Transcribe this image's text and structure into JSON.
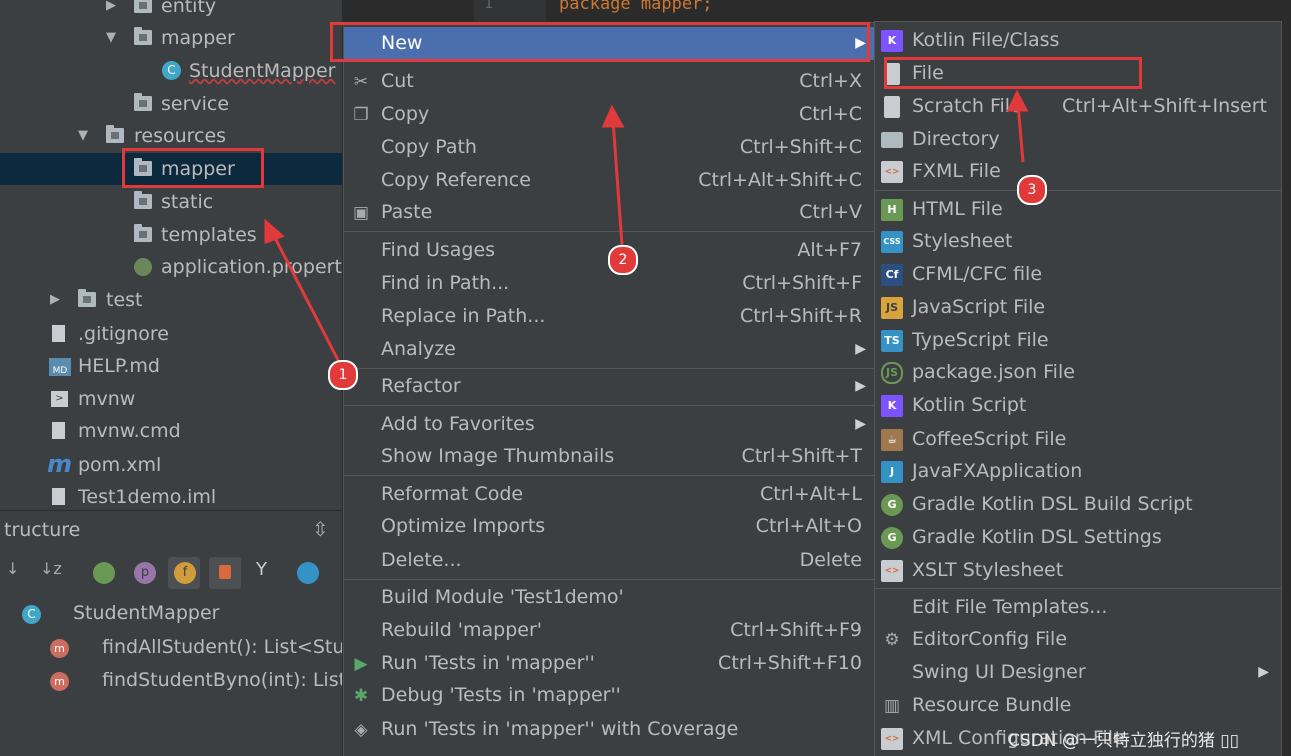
{
  "editor": {
    "line_number": "1",
    "code": "package mapper;"
  },
  "tree": {
    "items": [
      {
        "label": "entity"
      },
      {
        "label": "mapper"
      },
      {
        "label": "StudentMapper"
      },
      {
        "label": "service"
      },
      {
        "label": "resources"
      },
      {
        "label": "mapper"
      },
      {
        "label": "static"
      },
      {
        "label": "templates"
      },
      {
        "label": "application.properti"
      },
      {
        "label": "test"
      },
      {
        "label": ".gitignore"
      },
      {
        "label": "HELP.md"
      },
      {
        "label": "mvnw"
      },
      {
        "label": "mvnw.cmd"
      },
      {
        "label": "pom.xml"
      },
      {
        "label": "Test1demo.iml"
      }
    ]
  },
  "structure": {
    "title": "tructure",
    "class_name": "StudentMapper",
    "methods": [
      {
        "label": "findAllStudent(): List<Stud"
      },
      {
        "label": "findStudentByno(int): List<"
      }
    ],
    "toolbar_icons": [
      "sort-visibility-icon",
      "sort-alpha-icon",
      "inherited-icon",
      "properties-icon",
      "fields-icon",
      "non-public-icon",
      "anonymous-icon",
      "lambdas-icon"
    ]
  },
  "context_menu": {
    "items": [
      {
        "label": "New",
        "shortcut": ""
      },
      {
        "label": "Cut",
        "shortcut": "Ctrl+X"
      },
      {
        "label": "Copy",
        "shortcut": "Ctrl+C"
      },
      {
        "label": "Copy Path",
        "shortcut": "Ctrl+Shift+C"
      },
      {
        "label": "Copy Reference",
        "shortcut": "Ctrl+Alt+Shift+C"
      },
      {
        "label": "Paste",
        "shortcut": "Ctrl+V"
      },
      {
        "label": "Find Usages",
        "shortcut": "Alt+F7"
      },
      {
        "label": "Find in Path...",
        "shortcut": "Ctrl+Shift+F"
      },
      {
        "label": "Replace in Path...",
        "shortcut": "Ctrl+Shift+R"
      },
      {
        "label": "Analyze",
        "shortcut": ""
      },
      {
        "label": "Refactor",
        "shortcut": ""
      },
      {
        "label": "Add to Favorites",
        "shortcut": ""
      },
      {
        "label": "Show Image Thumbnails",
        "shortcut": "Ctrl+Shift+T"
      },
      {
        "label": "Reformat Code",
        "shortcut": "Ctrl+Alt+L"
      },
      {
        "label": "Optimize Imports",
        "shortcut": "Ctrl+Alt+O"
      },
      {
        "label": "Delete...",
        "shortcut": "Delete"
      },
      {
        "label": "Build Module 'Test1demo'",
        "shortcut": ""
      },
      {
        "label": "Rebuild 'mapper'",
        "shortcut": "Ctrl+Shift+F9"
      },
      {
        "label": "Run 'Tests in 'mapper''",
        "shortcut": "Ctrl+Shift+F10"
      },
      {
        "label": "Debug 'Tests in 'mapper''",
        "shortcut": ""
      },
      {
        "label": "Run 'Tests in 'mapper'' with Coverage",
        "shortcut": ""
      }
    ]
  },
  "new_submenu": {
    "items": [
      {
        "label": "Kotlin File/Class",
        "shortcut": ""
      },
      {
        "label": "File",
        "shortcut": ""
      },
      {
        "label": "Scratch File",
        "shortcut": "Ctrl+Alt+Shift+Insert"
      },
      {
        "label": "Directory",
        "shortcut": ""
      },
      {
        "label": "FXML File",
        "shortcut": ""
      },
      {
        "label": "HTML File",
        "shortcut": ""
      },
      {
        "label": "Stylesheet",
        "shortcut": ""
      },
      {
        "label": "CFML/CFC file",
        "shortcut": ""
      },
      {
        "label": "JavaScript File",
        "shortcut": ""
      },
      {
        "label": "TypeScript File",
        "shortcut": ""
      },
      {
        "label": "package.json File",
        "shortcut": ""
      },
      {
        "label": "Kotlin Script",
        "shortcut": ""
      },
      {
        "label": "CoffeeScript File",
        "shortcut": ""
      },
      {
        "label": "JavaFXApplication",
        "shortcut": ""
      },
      {
        "label": "Gradle Kotlin DSL Build Script",
        "shortcut": ""
      },
      {
        "label": "Gradle Kotlin DSL Settings",
        "shortcut": ""
      },
      {
        "label": "XSLT Stylesheet",
        "shortcut": ""
      },
      {
        "label": "Edit File Templates...",
        "shortcut": ""
      },
      {
        "label": "EditorConfig File",
        "shortcut": ""
      },
      {
        "label": "Swing UI Designer",
        "shortcut": ""
      },
      {
        "label": "Resource Bundle",
        "shortcut": ""
      },
      {
        "label": "XML Configuration File",
        "shortcut": ""
      }
    ]
  },
  "annotations": {
    "badges": [
      "1",
      "2",
      "3"
    ],
    "color": "#e03a3a"
  },
  "watermark": "CSDN @一只特立独行的猪 ▯▯",
  "colors": {
    "menu_bg": "#3c3f41",
    "highlight": "#4b6eaf",
    "tree_selection": "#0d293e",
    "text": "#bbbbbb"
  }
}
